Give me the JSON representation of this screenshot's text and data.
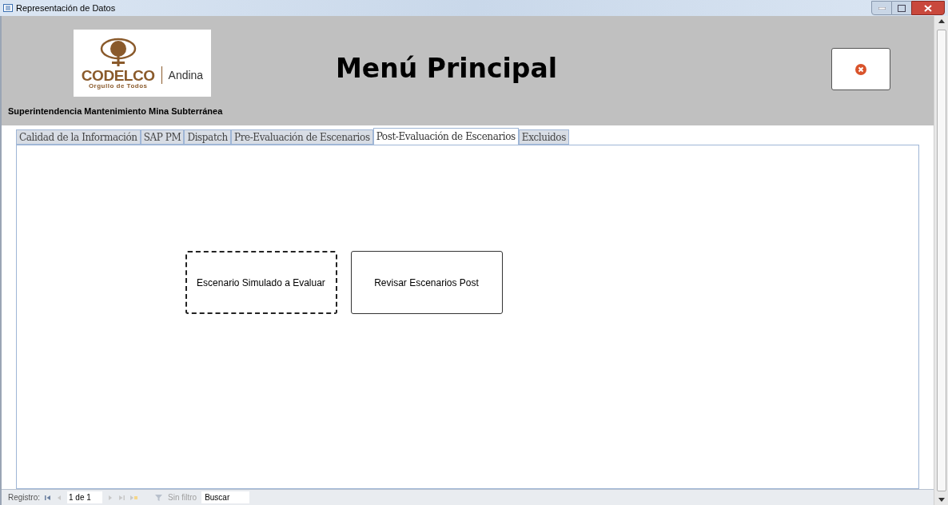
{
  "window": {
    "title": "Representación de Datos"
  },
  "header": {
    "logo": {
      "brand": "CODELCO",
      "tagline": "Orgullo de Todos",
      "division": "Andina"
    },
    "title": "Menú Principal",
    "subtitle": "Superintendencia Mantenimiento Mina Subterránea"
  },
  "tabs": [
    {
      "label": "Calidad de la Información",
      "selected": false
    },
    {
      "label": "SAP PM",
      "selected": false
    },
    {
      "label": "Dispatch",
      "selected": false
    },
    {
      "label": "Pre-Evaluación de Escenarios",
      "selected": false
    },
    {
      "label": "Post-Evaluación de Escenarios",
      "selected": true
    },
    {
      "label": "Excluidos",
      "selected": false
    }
  ],
  "buttons": [
    {
      "label": "Escenario Simulado a Evaluar",
      "focused": true
    },
    {
      "label": "Revisar Escenarios Post",
      "focused": false
    }
  ],
  "status_bar": {
    "label": "Registro:",
    "position": "1 de 1",
    "filter": "Sin filtro",
    "search_value": "Buscar"
  }
}
